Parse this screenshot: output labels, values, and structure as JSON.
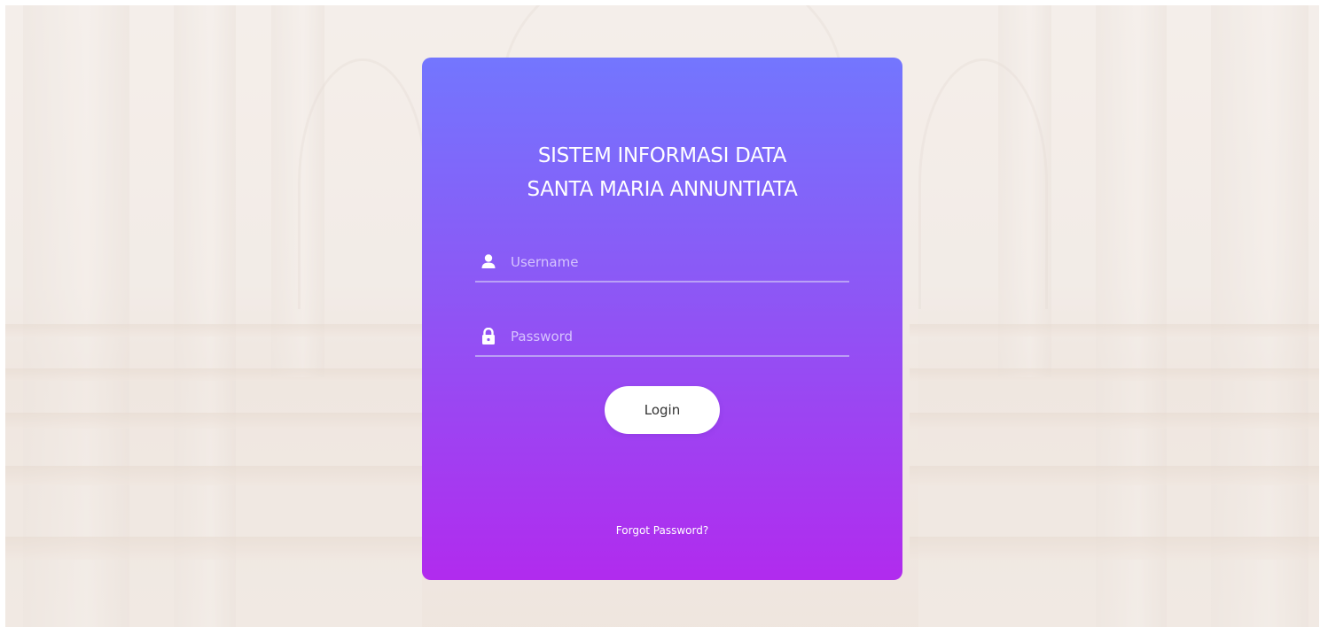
{
  "login": {
    "title_line1": "SISTEM INFORMASI DATA",
    "title_line2": "SANTA MARIA ANNUNTIATA",
    "username": {
      "placeholder": "Username",
      "value": "",
      "icon": "user-icon"
    },
    "password": {
      "placeholder": "Password",
      "value": "",
      "icon": "lock-icon"
    },
    "login_label": "Login",
    "forgot_label": "Forgot Password?"
  },
  "colors": {
    "card_gradient_top": "#7376fe",
    "card_gradient_mid": "#8d57f5",
    "card_gradient_bottom": "#b12bee",
    "button_bg": "#ffffff",
    "button_text": "#333333"
  }
}
